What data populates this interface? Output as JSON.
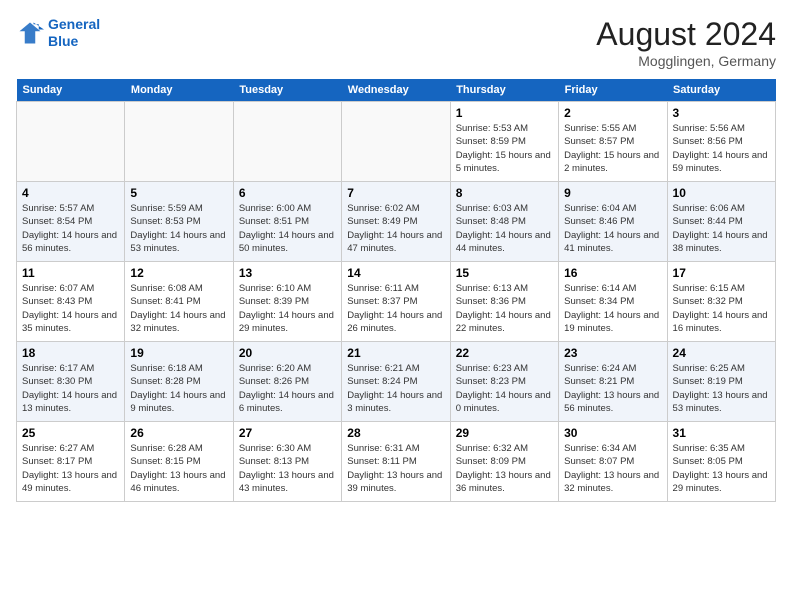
{
  "header": {
    "logo_line1": "General",
    "logo_line2": "Blue",
    "month": "August 2024",
    "location": "Mogglingen, Germany"
  },
  "days_of_week": [
    "Sunday",
    "Monday",
    "Tuesday",
    "Wednesday",
    "Thursday",
    "Friday",
    "Saturday"
  ],
  "weeks": [
    [
      {
        "day": "",
        "info": ""
      },
      {
        "day": "",
        "info": ""
      },
      {
        "day": "",
        "info": ""
      },
      {
        "day": "",
        "info": ""
      },
      {
        "day": "1",
        "info": "Sunrise: 5:53 AM\nSunset: 8:59 PM\nDaylight: 15 hours\nand 5 minutes."
      },
      {
        "day": "2",
        "info": "Sunrise: 5:55 AM\nSunset: 8:57 PM\nDaylight: 15 hours\nand 2 minutes."
      },
      {
        "day": "3",
        "info": "Sunrise: 5:56 AM\nSunset: 8:56 PM\nDaylight: 14 hours\nand 59 minutes."
      }
    ],
    [
      {
        "day": "4",
        "info": "Sunrise: 5:57 AM\nSunset: 8:54 PM\nDaylight: 14 hours\nand 56 minutes."
      },
      {
        "day": "5",
        "info": "Sunrise: 5:59 AM\nSunset: 8:53 PM\nDaylight: 14 hours\nand 53 minutes."
      },
      {
        "day": "6",
        "info": "Sunrise: 6:00 AM\nSunset: 8:51 PM\nDaylight: 14 hours\nand 50 minutes."
      },
      {
        "day": "7",
        "info": "Sunrise: 6:02 AM\nSunset: 8:49 PM\nDaylight: 14 hours\nand 47 minutes."
      },
      {
        "day": "8",
        "info": "Sunrise: 6:03 AM\nSunset: 8:48 PM\nDaylight: 14 hours\nand 44 minutes."
      },
      {
        "day": "9",
        "info": "Sunrise: 6:04 AM\nSunset: 8:46 PM\nDaylight: 14 hours\nand 41 minutes."
      },
      {
        "day": "10",
        "info": "Sunrise: 6:06 AM\nSunset: 8:44 PM\nDaylight: 14 hours\nand 38 minutes."
      }
    ],
    [
      {
        "day": "11",
        "info": "Sunrise: 6:07 AM\nSunset: 8:43 PM\nDaylight: 14 hours\nand 35 minutes."
      },
      {
        "day": "12",
        "info": "Sunrise: 6:08 AM\nSunset: 8:41 PM\nDaylight: 14 hours\nand 32 minutes."
      },
      {
        "day": "13",
        "info": "Sunrise: 6:10 AM\nSunset: 8:39 PM\nDaylight: 14 hours\nand 29 minutes."
      },
      {
        "day": "14",
        "info": "Sunrise: 6:11 AM\nSunset: 8:37 PM\nDaylight: 14 hours\nand 26 minutes."
      },
      {
        "day": "15",
        "info": "Sunrise: 6:13 AM\nSunset: 8:36 PM\nDaylight: 14 hours\nand 22 minutes."
      },
      {
        "day": "16",
        "info": "Sunrise: 6:14 AM\nSunset: 8:34 PM\nDaylight: 14 hours\nand 19 minutes."
      },
      {
        "day": "17",
        "info": "Sunrise: 6:15 AM\nSunset: 8:32 PM\nDaylight: 14 hours\nand 16 minutes."
      }
    ],
    [
      {
        "day": "18",
        "info": "Sunrise: 6:17 AM\nSunset: 8:30 PM\nDaylight: 14 hours\nand 13 minutes."
      },
      {
        "day": "19",
        "info": "Sunrise: 6:18 AM\nSunset: 8:28 PM\nDaylight: 14 hours\nand 9 minutes."
      },
      {
        "day": "20",
        "info": "Sunrise: 6:20 AM\nSunset: 8:26 PM\nDaylight: 14 hours\nand 6 minutes."
      },
      {
        "day": "21",
        "info": "Sunrise: 6:21 AM\nSunset: 8:24 PM\nDaylight: 14 hours\nand 3 minutes."
      },
      {
        "day": "22",
        "info": "Sunrise: 6:23 AM\nSunset: 8:23 PM\nDaylight: 14 hours\nand 0 minutes."
      },
      {
        "day": "23",
        "info": "Sunrise: 6:24 AM\nSunset: 8:21 PM\nDaylight: 13 hours\nand 56 minutes."
      },
      {
        "day": "24",
        "info": "Sunrise: 6:25 AM\nSunset: 8:19 PM\nDaylight: 13 hours\nand 53 minutes."
      }
    ],
    [
      {
        "day": "25",
        "info": "Sunrise: 6:27 AM\nSunset: 8:17 PM\nDaylight: 13 hours\nand 49 minutes."
      },
      {
        "day": "26",
        "info": "Sunrise: 6:28 AM\nSunset: 8:15 PM\nDaylight: 13 hours\nand 46 minutes."
      },
      {
        "day": "27",
        "info": "Sunrise: 6:30 AM\nSunset: 8:13 PM\nDaylight: 13 hours\nand 43 minutes."
      },
      {
        "day": "28",
        "info": "Sunrise: 6:31 AM\nSunset: 8:11 PM\nDaylight: 13 hours\nand 39 minutes."
      },
      {
        "day": "29",
        "info": "Sunrise: 6:32 AM\nSunset: 8:09 PM\nDaylight: 13 hours\nand 36 minutes."
      },
      {
        "day": "30",
        "info": "Sunrise: 6:34 AM\nSunset: 8:07 PM\nDaylight: 13 hours\nand 32 minutes."
      },
      {
        "day": "31",
        "info": "Sunrise: 6:35 AM\nSunset: 8:05 PM\nDaylight: 13 hours\nand 29 minutes."
      }
    ]
  ]
}
